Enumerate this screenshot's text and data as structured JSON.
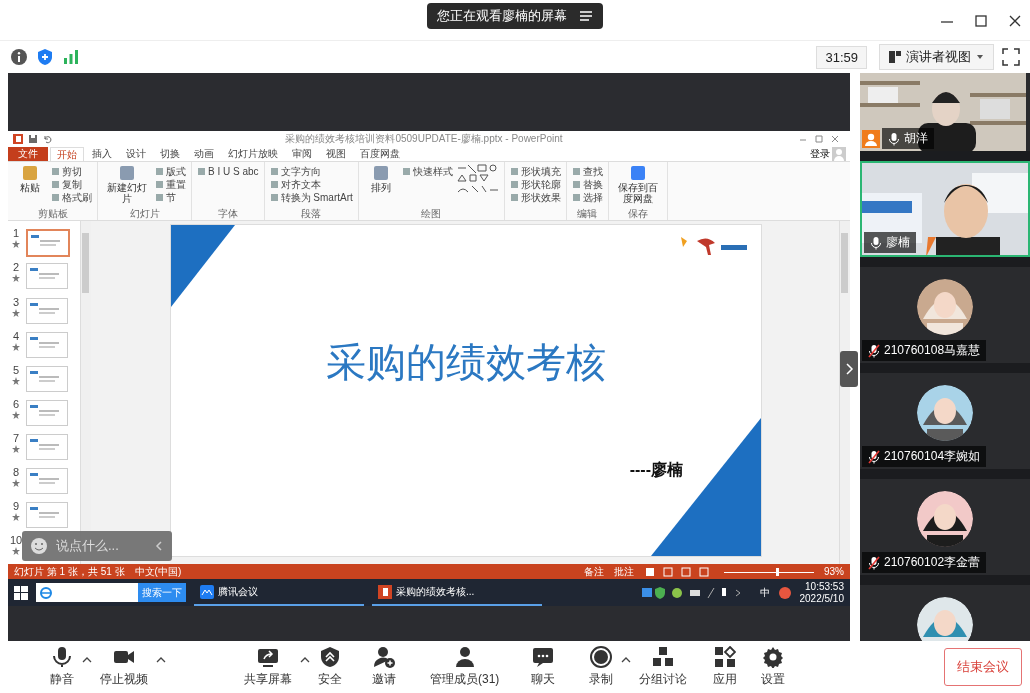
{
  "banner": {
    "text": "您正在观看廖楠的屏幕"
  },
  "toolbar": {
    "timer": "31:59",
    "view": "演讲者视图"
  },
  "shared_screen": {
    "powerpoint": {
      "title": "采购的绩效考核培训资料0509UPDATE-廖楠.pptx - PowerPoint",
      "account": "登录",
      "tabs": [
        {
          "label": "文件",
          "kind": "file",
          "selected": false
        },
        {
          "label": "开始",
          "kind": "tab",
          "selected": true
        },
        {
          "label": "插入",
          "kind": "tab",
          "selected": false
        },
        {
          "label": "设计",
          "kind": "tab",
          "selected": false
        },
        {
          "label": "切换",
          "kind": "tab",
          "selected": false
        },
        {
          "label": "动画",
          "kind": "tab",
          "selected": false
        },
        {
          "label": "幻灯片放映",
          "kind": "tab",
          "selected": false
        },
        {
          "label": "审阅",
          "kind": "tab",
          "selected": false
        },
        {
          "label": "视图",
          "kind": "tab",
          "selected": false
        },
        {
          "label": "百度网盘",
          "kind": "tab",
          "selected": false
        }
      ],
      "ribbon_groups": [
        {
          "label": "剪贴板",
          "large": "粘贴",
          "items": [
            "剪切",
            "复制",
            "格式刷"
          ]
        },
        {
          "label": "幻灯片",
          "large": "新建幻灯片",
          "items": [
            "版式",
            "重置",
            "节"
          ]
        },
        {
          "label": "字体",
          "items": [
            "B  I  U  S  abc"
          ]
        },
        {
          "label": "段落",
          "items": [
            "文字方向",
            "对齐文本",
            "转换为 SmartArt"
          ]
        },
        {
          "label": "绘图",
          "large": "排列",
          "items": [
            "快速样式"
          ]
        },
        {
          "items": [
            "形状填充",
            "形状轮廓",
            "形状效果"
          ]
        },
        {
          "label": "编辑",
          "items": [
            "查找",
            "替换",
            "选择"
          ]
        },
        {
          "label": "保存",
          "large": "保存到百度网盘"
        }
      ],
      "thumbnails": [
        {
          "number": "1",
          "selected": true
        },
        {
          "number": "2",
          "selected": false
        },
        {
          "number": "3",
          "selected": false
        },
        {
          "number": "4",
          "selected": false
        },
        {
          "number": "5",
          "selected": false
        },
        {
          "number": "6",
          "selected": false
        },
        {
          "number": "7",
          "selected": false
        },
        {
          "number": "8",
          "selected": false
        },
        {
          "number": "9",
          "selected": false
        },
        {
          "number": "10",
          "selected": false
        }
      ],
      "slide": {
        "title": "采购的绩效考核",
        "author": "----廖楠"
      },
      "status": {
        "slide_info": "幻灯片 第 1 张，共 51 张",
        "language": "中文(中国)",
        "notes": "备注",
        "comments": "批注",
        "zoom": "93%",
        "zoom_slider": {
          "level": 0.6
        }
      }
    },
    "taskbar": {
      "search_button": "搜索一下",
      "apps": [
        "腾讯会议",
        "采购的绩效考核..."
      ],
      "ime": "中",
      "time": "10:53:53",
      "date": "2022/5/10"
    },
    "chat": {
      "placeholder": "说点什么..."
    }
  },
  "participants": [
    {
      "name": "胡洋",
      "kind": "video",
      "host": true,
      "muted": false,
      "active": false
    },
    {
      "name": "廖楠",
      "kind": "video",
      "host": false,
      "muted": false,
      "active": true
    },
    {
      "name": "210760108马嘉慧",
      "kind": "avatar",
      "host": false,
      "muted": true,
      "active": false
    },
    {
      "name": "210760104李婉如",
      "kind": "avatar",
      "host": false,
      "muted": true,
      "active": false
    },
    {
      "name": "210760102李金蕾",
      "kind": "avatar",
      "host": false,
      "muted": true,
      "active": false
    },
    {
      "kind": "avatar",
      "active": false
    }
  ],
  "controls": [
    {
      "label": "静音",
      "has_menu": true
    },
    {
      "label": "停止视频",
      "has_menu": true
    },
    {
      "label": "共享屏幕",
      "has_menu": true
    },
    {
      "label": "安全",
      "has_menu": false
    },
    {
      "label": "邀请",
      "has_menu": false
    },
    {
      "label": "管理成员(31)",
      "has_menu": false
    },
    {
      "label": "聊天",
      "has_menu": false
    },
    {
      "label": "录制",
      "has_menu": true
    },
    {
      "label": "分组讨论",
      "has_menu": false
    },
    {
      "label": "应用",
      "has_menu": false
    },
    {
      "label": "设置",
      "has_menu": false
    }
  ],
  "end_button": "结束会议"
}
